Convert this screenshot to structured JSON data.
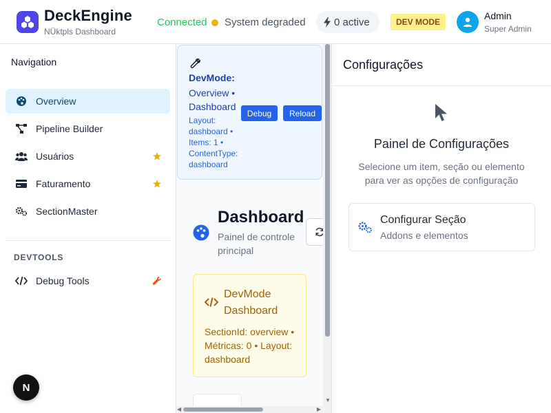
{
  "header": {
    "app_title": "DeckEngine",
    "app_subtitle": "NÜktpls Dashboard",
    "connection_status": "Connected",
    "system_status": "System degraded",
    "active_count": "0 active",
    "dev_mode_badge": "DEV MODE",
    "user": {
      "name": "Admin",
      "role": "Super Admin"
    },
    "colors": {
      "connected": "#22c55e",
      "degraded": "#eab308",
      "brand": "#4f46e5"
    }
  },
  "sidebar": {
    "title": "Navigation",
    "items": [
      {
        "label": "Overview",
        "icon": "palette-icon",
        "active": true
      },
      {
        "label": "Pipeline Builder",
        "icon": "pipeline-icon"
      },
      {
        "label": "Usuários",
        "icon": "users-icon",
        "starred": true
      },
      {
        "label": "Faturamento",
        "icon": "credit-card-icon",
        "starred": true
      },
      {
        "label": "SectionMaster",
        "icon": "cogs-icon"
      }
    ],
    "devtools_title": "DEVTOOLS",
    "devtools_items": [
      {
        "label": "Debug Tools",
        "icon": "code-icon",
        "badge_icon": "wrench-icon"
      }
    ],
    "next_badge": "N"
  },
  "dev_card": {
    "title": "DevMode:",
    "subtitle": "Overview • Dashboard",
    "meta": "Layout: dashboard • Items: 1 • ContentType: dashboard",
    "debug_label": "Debug",
    "reload_label": "Reload"
  },
  "dashboard": {
    "title": "Dashboard",
    "subtitle": "Painel de controle principal",
    "devmode_card": {
      "title": "DevMode Dashboard",
      "meta": "SectionId: overview • Métricas: 0 • Layout: dashboard"
    }
  },
  "config_panel": {
    "header": "Configurações",
    "title": "Painel de Configurações",
    "description": "Selecione um item, seção ou elemento para ver as opções de configuração",
    "card": {
      "title": "Configurar Seção",
      "subtitle": "Addons e elementos"
    }
  }
}
